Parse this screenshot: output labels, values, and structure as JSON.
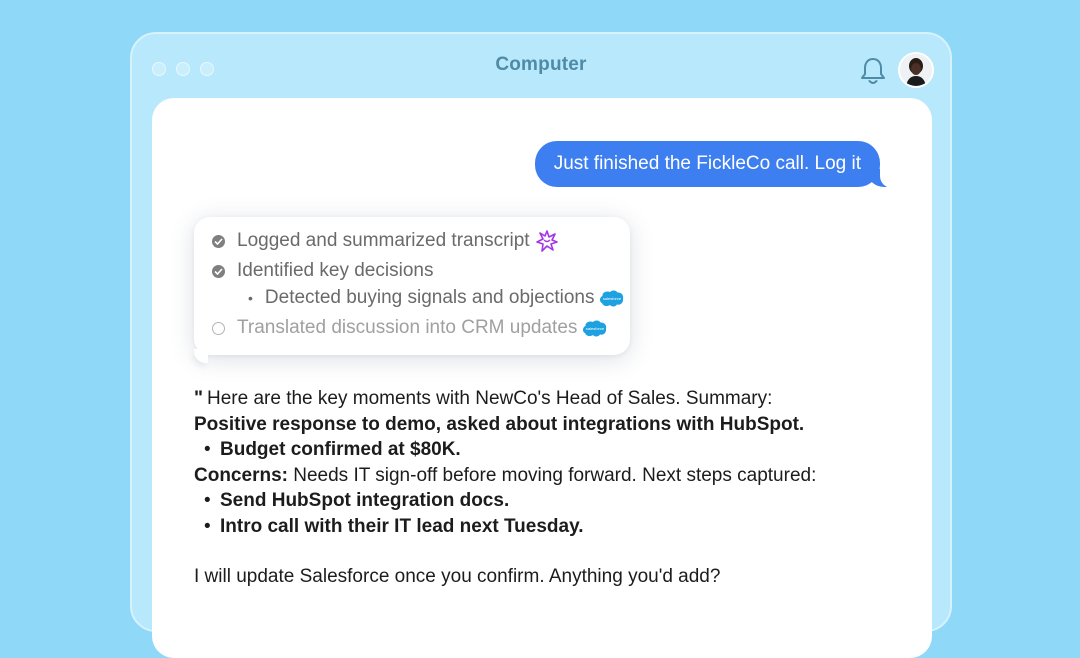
{
  "window": {
    "title": "Computer"
  },
  "header": {
    "bell_icon": "bell-icon",
    "avatar_icon": "user-avatar"
  },
  "user_message": "Just finished the FickleCo call. Log it",
  "tasks": [
    {
      "label": "Logged and summarized transcript",
      "status": "done",
      "badge_icon": "sparkle-icon"
    },
    {
      "label": "Identified key decisions",
      "status": "done"
    },
    {
      "label": "Detected buying signals and objections",
      "status": "sub",
      "badge_icon": "salesforce-icon"
    },
    {
      "label": "Translated discussion into CRM updates",
      "status": "pending",
      "badge_icon": "salesforce-icon"
    }
  ],
  "reply": {
    "quote_mark": "\"",
    "intro": "Here are the key moments with NewCo's Head of Sales. Summary:",
    "positive": "Positive response to demo, asked about integrations with HubSpot.",
    "budget": "Budget confirmed at $80K.",
    "concerns_label": "Concerns:",
    "concerns_text": " Needs IT sign-off before moving forward. Next steps captured:",
    "step1": "Send HubSpot integration docs.",
    "step2": "Intro call with their IT lead next Tuesday.",
    "closing": "I will update Salesforce once you confirm. Anything you'd add?"
  },
  "colors": {
    "background": "#8fd8f8",
    "user_bubble": "#3d7ff0",
    "sparkle": "#a335e8",
    "salesforce": "#1ea1e0"
  }
}
